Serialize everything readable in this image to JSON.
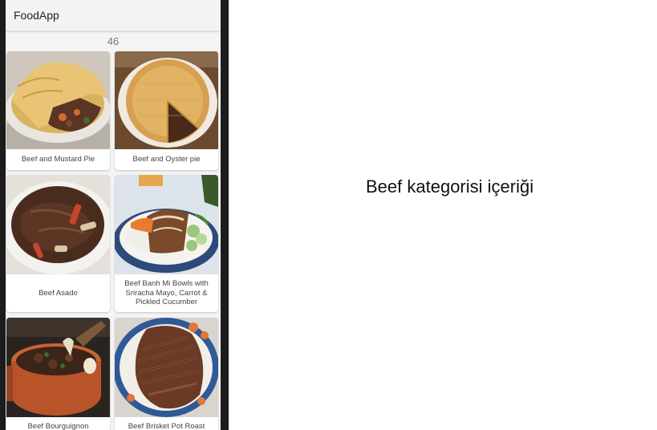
{
  "app": {
    "title": "FoodApp"
  },
  "meal_count": "46",
  "meals": [
    {
      "name": "Beef and Mustard Pie",
      "image": "pie-with-stew-photo"
    },
    {
      "name": "Beef and Oyster pie",
      "image": "sliced-pie-photo"
    },
    {
      "name": "Beef Asado",
      "image": "braised-beef-photo"
    },
    {
      "name": "Beef Banh Mi Bowls with Sriracha Mayo, Carrot & Pickled Cucumber",
      "image": "rice-bowl-photo"
    },
    {
      "name": "Beef Bourguignon",
      "image": "stew-pot-photo"
    },
    {
      "name": "Beef Brisket Pot Roast",
      "image": "sliced-brisket-photo"
    }
  ],
  "caption": "Beef kategorisi içeriği",
  "colors": {
    "app_bar": "#f3f3f3",
    "phone_frame": "#1c1c1c",
    "card_background": "#ffffff"
  }
}
